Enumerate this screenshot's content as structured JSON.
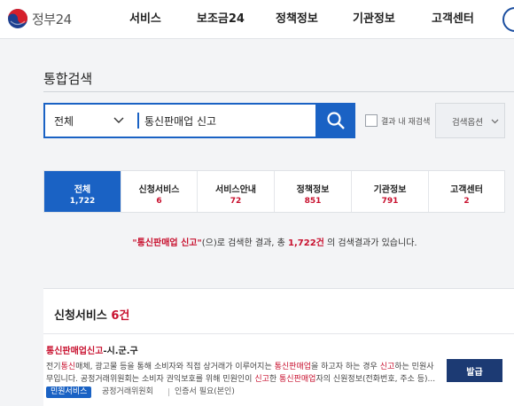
{
  "header": {
    "logo_text": "정부24",
    "nav": [
      "서비스",
      "보조금24",
      "정책정보",
      "기관정보",
      "고객센터"
    ]
  },
  "search": {
    "section_title": "통합검색",
    "scope": "전체",
    "query": "통신판매업 신고",
    "checkbox_label": "결과 내 재검색",
    "options_label": "검색옵션"
  },
  "tabs": [
    {
      "label": "전체",
      "count": "1,722"
    },
    {
      "label": "신청서비스",
      "count": "6"
    },
    {
      "label": "서비스안내",
      "count": "72"
    },
    {
      "label": "정책정보",
      "count": "851"
    },
    {
      "label": "기관정보",
      "count": "791"
    },
    {
      "label": "고객센터",
      "count": "2"
    }
  ],
  "summary": {
    "keyword": "\"통신판매업 신고\"",
    "mid": "(으)로 검색한 결과, 총 ",
    "count": "1,722건",
    "end": " 의 검색결과가 있습니다."
  },
  "section": {
    "title": "신청서비스",
    "count": "6건"
  },
  "result": {
    "title_hl": "통신판매업신고",
    "title_rest": "-시.군.구",
    "line1": [
      "전기",
      "통신",
      "매체, 광고물 등을 통해 소비자와 직접 상거래가 이루어지는 ",
      "통신판매업",
      "을 하고자 하는 경우 ",
      "신고",
      "하는 민원사"
    ],
    "line2": [
      "무입니다. 공정거래위원회는 소비자 권익보호를 위해 민원인이 ",
      "신고",
      "한 ",
      "통신판매업",
      "자의 신원정보(전화번호, 주소 등)..."
    ],
    "badge": "민원서비스",
    "agency": "공정거래위원회",
    "cert": "인증서 필요(본인)",
    "apply_label": "발급"
  },
  "colors": {
    "primary": "#1a62c4",
    "highlight": "#c8102e",
    "apply_button": "#1c3a73"
  }
}
